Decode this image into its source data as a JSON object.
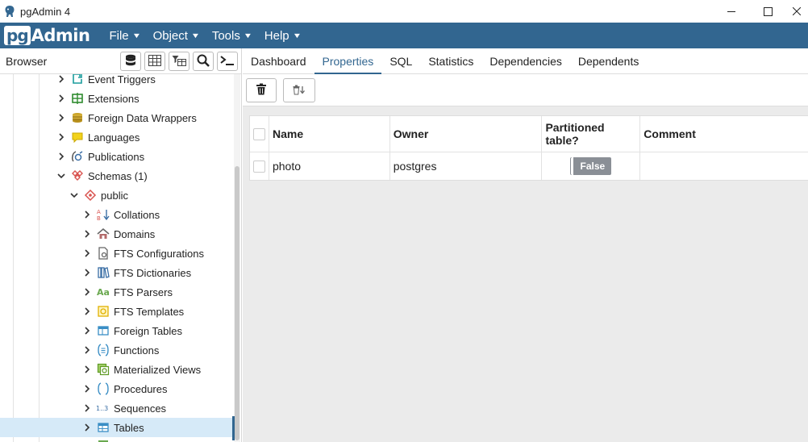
{
  "window": {
    "title": "pgAdmin 4"
  },
  "menubar": {
    "logo_pg": "pg",
    "logo_admin": "Admin",
    "items": [
      {
        "label": "File"
      },
      {
        "label": "Object"
      },
      {
        "label": "Tools"
      },
      {
        "label": "Help"
      }
    ]
  },
  "browser": {
    "title": "Browser",
    "tree": [
      {
        "label": "Event Triggers",
        "icon": "event-trigger-icon",
        "expanded": false
      },
      {
        "label": "Extensions",
        "icon": "extension-icon",
        "expanded": false
      },
      {
        "label": "Foreign Data Wrappers",
        "icon": "foreign-data-wrapper-icon",
        "expanded": false
      },
      {
        "label": "Languages",
        "icon": "language-icon",
        "expanded": false
      },
      {
        "label": "Publications",
        "icon": "publication-icon",
        "expanded": false
      },
      {
        "label": "Schemas (1)",
        "icon": "schemas-icon",
        "expanded": true
      },
      {
        "label": "public",
        "icon": "schema-icon",
        "expanded": true
      },
      {
        "label": "Collations",
        "icon": "collation-icon",
        "expanded": false
      },
      {
        "label": "Domains",
        "icon": "domain-icon",
        "expanded": false
      },
      {
        "label": "FTS Configurations",
        "icon": "fts-configuration-icon",
        "expanded": false
      },
      {
        "label": "FTS Dictionaries",
        "icon": "fts-dictionary-icon",
        "expanded": false
      },
      {
        "label": "FTS Parsers",
        "icon": "fts-parser-icon",
        "expanded": false
      },
      {
        "label": "FTS Templates",
        "icon": "fts-template-icon",
        "expanded": false
      },
      {
        "label": "Foreign Tables",
        "icon": "foreign-table-icon",
        "expanded": false
      },
      {
        "label": "Functions",
        "icon": "function-icon",
        "expanded": false
      },
      {
        "label": "Materialized Views",
        "icon": "materialized-view-icon",
        "expanded": false
      },
      {
        "label": "Procedures",
        "icon": "procedure-icon",
        "expanded": false
      },
      {
        "label": "Sequences",
        "icon": "sequence-icon",
        "expanded": false
      },
      {
        "label": "Tables",
        "icon": "table-icon",
        "expanded": false,
        "selected": true
      }
    ]
  },
  "tabs": [
    {
      "label": "Dashboard",
      "active": false
    },
    {
      "label": "Properties",
      "active": true
    },
    {
      "label": "SQL",
      "active": false
    },
    {
      "label": "Statistics",
      "active": false
    },
    {
      "label": "Dependencies",
      "active": false
    },
    {
      "label": "Dependents",
      "active": false
    }
  ],
  "properties": {
    "columns": [
      "Name",
      "Owner",
      "Partitioned table?",
      "Comment"
    ],
    "rows": [
      {
        "name": "photo",
        "owner": "postgres",
        "partitioned": "False",
        "comment": ""
      }
    ]
  },
  "colors": {
    "accent": "#326690",
    "selected_row": "#d6eaf8",
    "badge": "#8a8f96"
  }
}
